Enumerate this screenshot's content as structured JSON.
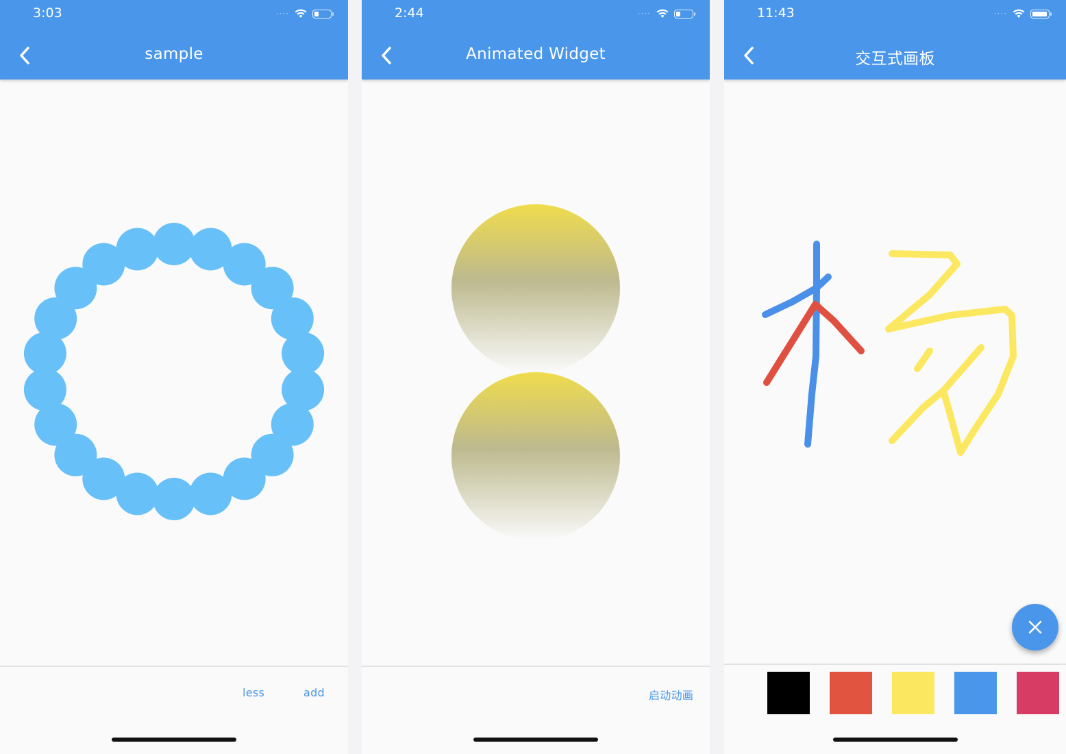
{
  "colors": {
    "appbar": "#4a96ea",
    "circle_bead": "#68c0f9",
    "button_text": "#4a96ea",
    "sphere_top": "#f0dc4c",
    "sphere_mid": "#bdb98e",
    "sphere_bottom": "#fafafa",
    "fab": "#4a96ea",
    "stroke_blue": "#4a90e8",
    "stroke_red": "#e05040",
    "stroke_yellow": "#fbe860"
  },
  "screens": [
    {
      "time": "3:03",
      "battery_level": 0.3,
      "back_icon": "chevron-left-icon",
      "title": "sample",
      "bead_count": 22,
      "buttons": {
        "less": "less",
        "add": "add"
      }
    },
    {
      "time": "2:44",
      "battery_level": 0.3,
      "back_icon": "chevron-left-icon",
      "title": "Animated Widget",
      "sphere_count": 2,
      "buttons": {
        "start": "启动动画"
      }
    },
    {
      "time": "11:43",
      "battery_level": 1.0,
      "back_icon": "chevron-left-icon",
      "title": "交互式画板",
      "fab_icon": "close-icon",
      "palette": [
        "#000000",
        "#e05440",
        "#fbe860",
        "#4a96ea",
        "#d73c64"
      ]
    }
  ]
}
